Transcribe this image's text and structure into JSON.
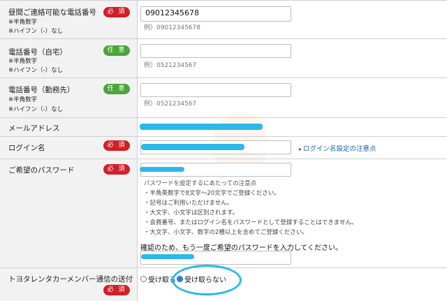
{
  "fields": {
    "daytime_phone": {
      "label": "昼間ご連絡可能な電話番号",
      "note1": "※半角数字",
      "note2": "※ハイフン（-）なし",
      "badge": "必 須",
      "value": "09012345678",
      "example": "例）09012345678"
    },
    "home_phone": {
      "label": "電話番号（自宅）",
      "note1": "※半角数字",
      "note2": "※ハイフン（-）なし",
      "badge": "任 意",
      "value": "",
      "example": "例）0521234567"
    },
    "work_phone": {
      "label": "電話番号（勤務先）",
      "note1": "※半角数字",
      "note2": "※ハイフン（-）なし",
      "badge": "任 意",
      "value": "",
      "example": "例）0521234567"
    },
    "email": {
      "label": "メールアドレス"
    },
    "login_name": {
      "label": "ログイン名",
      "badge": "必 須",
      "link": "ログイン名設定の注意点"
    },
    "password": {
      "label": "ご希望のパスワード",
      "badge": "必 須",
      "notes_title": "パスワードを設定するにあたっての注意点",
      "notes": [
        "・半角英数字で8文字〜20文字でご登録ください。",
        "・記号はご利用いただけません。",
        "・大文字、小文字は区別されます。",
        "・会員番号、またはログイン名をパスワードとして登録することはできません。",
        "・大文字、小文字、数字の2種以上を含めてご登録ください。"
      ],
      "confirm_text": "確認のため、もう一度ご希望のパスワードを入力してください。"
    },
    "newsletter": {
      "label": "トヨタレンタカーメンバー通信の送付",
      "badge": "必 須",
      "option_receive": "受け取る",
      "option_decline": "受け取らない",
      "selected": "受け取らない"
    }
  },
  "colors": {
    "required": "#d0202a",
    "optional": "#4aa53a",
    "scribble": "#2bb8ea",
    "link": "#1a5fb4"
  }
}
